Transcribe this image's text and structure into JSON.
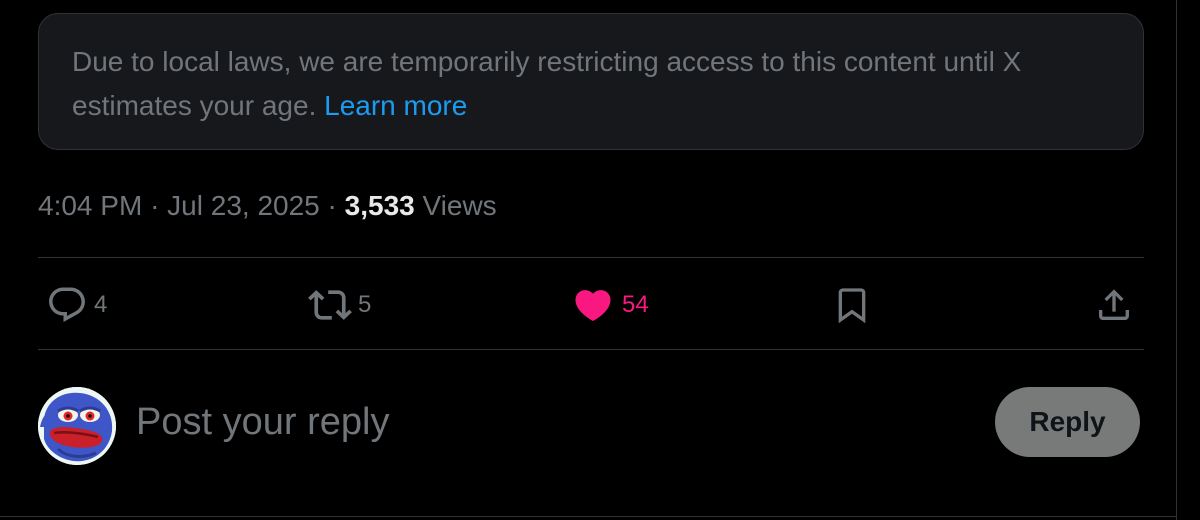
{
  "notice": {
    "text": "Due to local laws, we are temporarily restricting access to this content until X estimates your age.",
    "link_label": "Learn more"
  },
  "post_meta": {
    "time": "4:04 PM",
    "separator": "·",
    "date": "Jul 23, 2025",
    "views_count": "3,533",
    "views_label": "Views"
  },
  "actions": {
    "reply": {
      "icon": "reply-bubble-icon",
      "count": "4"
    },
    "repost": {
      "icon": "repost-icon",
      "count": "5"
    },
    "like": {
      "icon": "heart-icon",
      "count": "54",
      "active": true
    },
    "bookmark": {
      "icon": "bookmark-icon"
    },
    "share": {
      "icon": "share-upload-icon"
    }
  },
  "composer": {
    "avatar": "user-avatar-pepe",
    "placeholder": "Post your reply",
    "submit_label": "Reply"
  },
  "colors": {
    "background": "#000000",
    "card": "#16181c",
    "border": "#2f3336",
    "muted_text": "#71767b",
    "primary_text": "#e7e9ea",
    "link": "#1d9bf0",
    "like": "#f91880",
    "reply_button": "#787a7a"
  }
}
